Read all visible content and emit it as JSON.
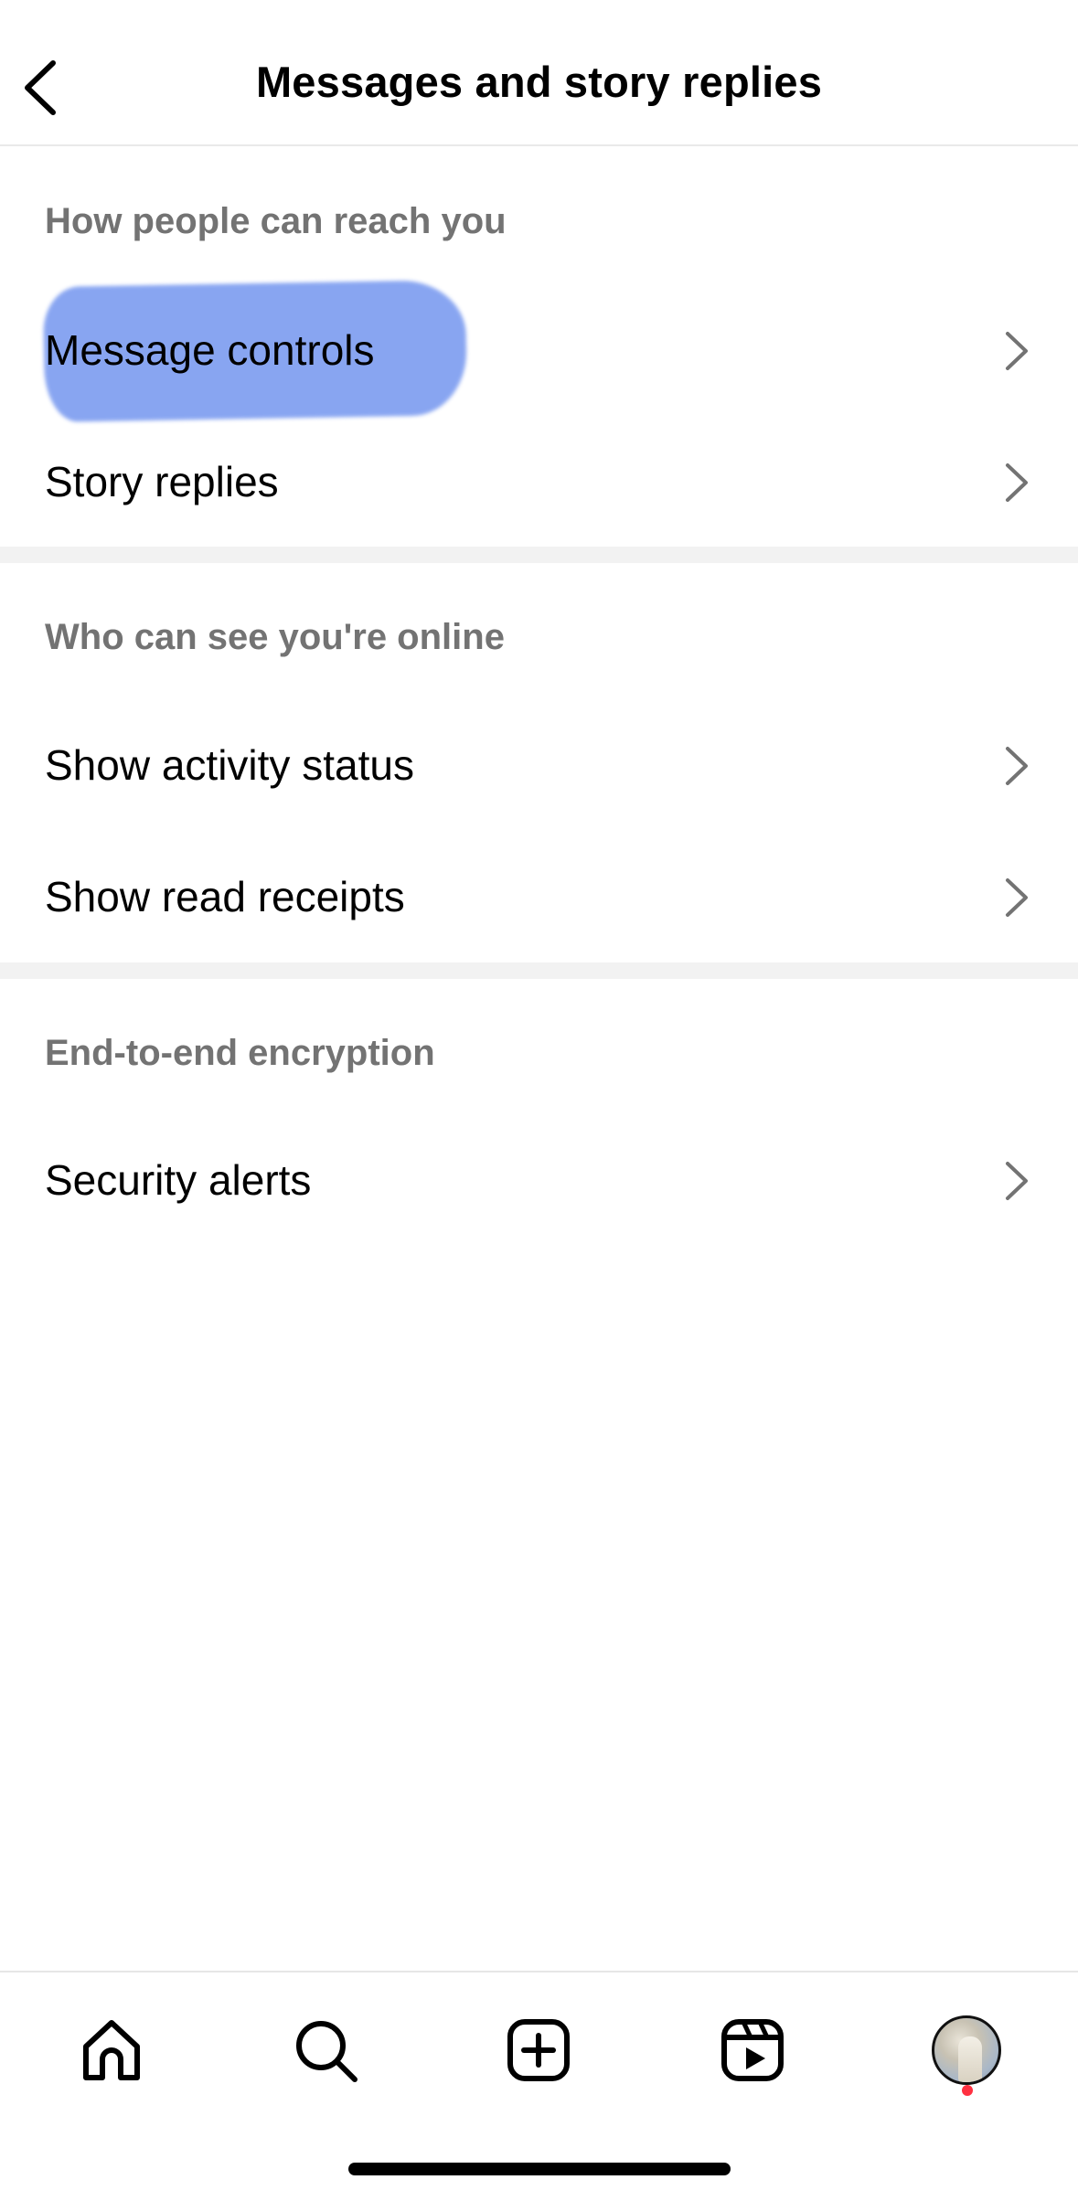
{
  "header": {
    "title": "Messages and story replies",
    "back_icon": "chevron-left-icon"
  },
  "sections": [
    {
      "title": "How people can reach you",
      "items": [
        {
          "label": "Message controls",
          "highlighted": true
        },
        {
          "label": "Story replies"
        }
      ]
    },
    {
      "title": "Who can see you're online",
      "items": [
        {
          "label": "Show activity status"
        },
        {
          "label": "Show read receipts"
        }
      ]
    },
    {
      "title": "End-to-end encryption",
      "items": [
        {
          "label": "Security alerts"
        }
      ]
    }
  ],
  "tabbar": {
    "icons": [
      "home-icon",
      "search-icon",
      "create-post-icon",
      "reels-icon",
      "profile-avatar"
    ],
    "notification_dot_color": "#ff3040"
  },
  "colors": {
    "section_title": "#737373",
    "divider": "#f2f2f2",
    "highlight": "#7c9cf0"
  }
}
